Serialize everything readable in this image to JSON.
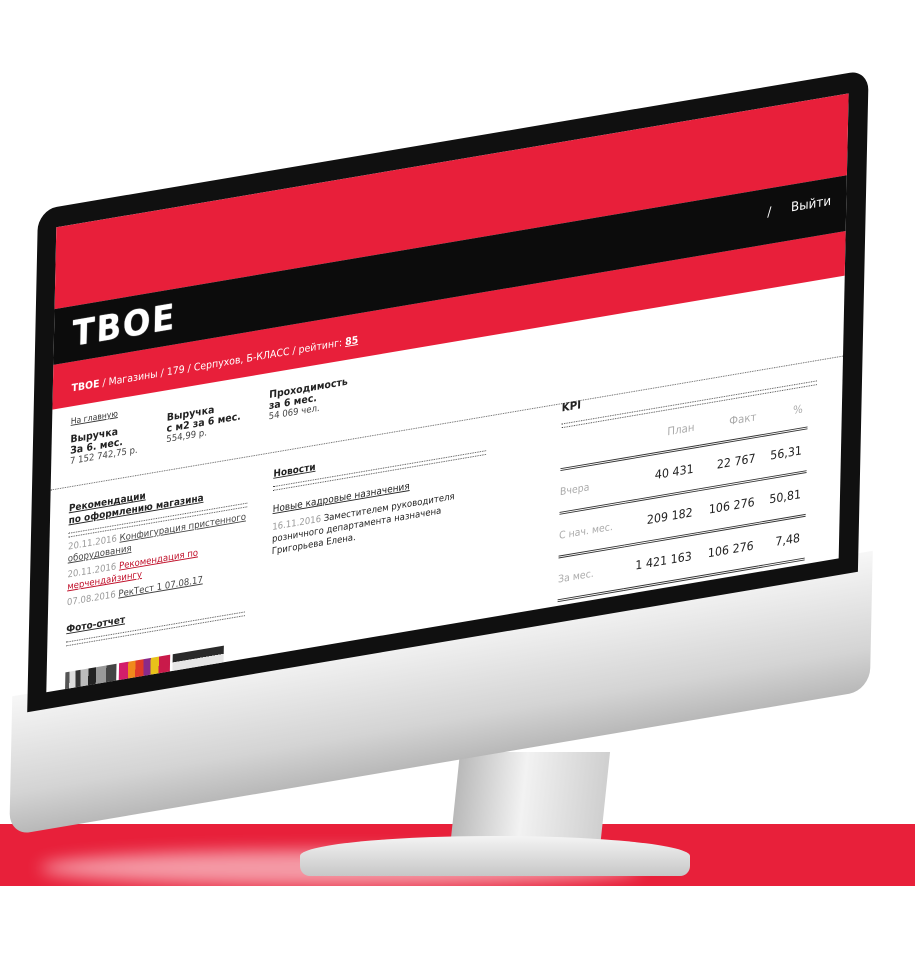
{
  "header": {
    "logo": "ТВОЕ",
    "separator": "/",
    "logout_label": "Выйти"
  },
  "breadcrumb": {
    "brand": "ТВОЕ",
    "path": " / Магазины / 179 / Серпухов, Б-КЛАСС / рейтинг: ",
    "rating": "85"
  },
  "stats": {
    "home_link": "На главную",
    "items": [
      {
        "title_line1": "Выручка",
        "title_line2": "За 6. мес.",
        "value": "7 152 742,75 р."
      },
      {
        "title_line1": "Выручка",
        "title_line2": "с м2 за 6 мес.",
        "value": "554,99 р."
      },
      {
        "title_line1": "Проходимость",
        "title_line2": "за 6 мес.",
        "value": "54 069 чел."
      }
    ]
  },
  "recommendations": {
    "title_line1": "Рекомендации",
    "title_line2": "по оформлению магазина",
    "items": [
      {
        "date": "20.11.2016",
        "text": "Конфигурация пристенного оборудования",
        "style": "normal"
      },
      {
        "date": "20.11.2016",
        "text": "Рекомендация по мерчендайзингу",
        "style": "red"
      },
      {
        "date": "07.08.2016",
        "text": "РекТест 1 07.08.17",
        "style": "normal"
      }
    ],
    "photo_title": "Фото-отчет"
  },
  "news": {
    "title": "Новости",
    "subtitle": "Новые кадровые назначения",
    "item_date": "16.11.2016",
    "item_text": "Заместителем руководителя розничного департамента назначена Григорьева Елена."
  },
  "kpi": {
    "title": "KPI",
    "columns": [
      "План",
      "Факт",
      "%"
    ],
    "rows": [
      {
        "label": "Вчера",
        "plan": "40 431",
        "fact": "22 767",
        "pct": "56,31"
      },
      {
        "label": "С нач. мес.",
        "plan": "209 182",
        "fact": "106 276",
        "pct": "50,81"
      },
      {
        "label": "За мес.",
        "plan": "1 421 163",
        "fact": "106 276",
        "pct": "7,48"
      }
    ]
  },
  "colors": {
    "brand_red": "#e81f3a",
    "header_black": "#0c0c0c"
  }
}
